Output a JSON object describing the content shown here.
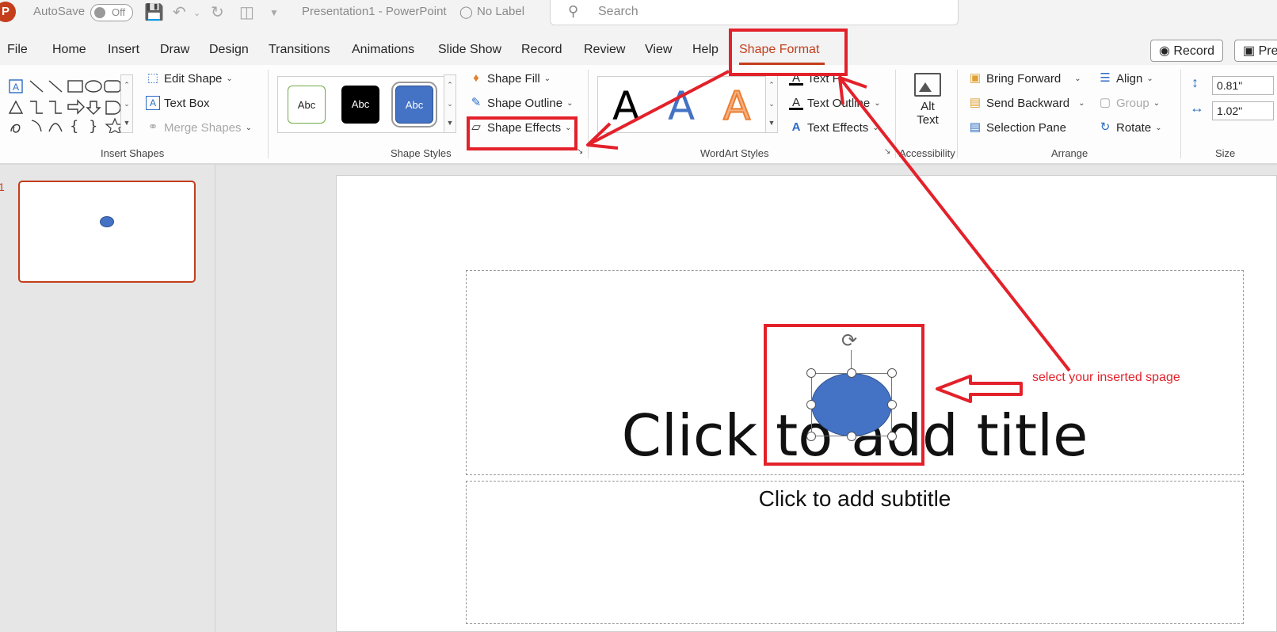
{
  "titlebar": {
    "app_logo": "P",
    "autosave_label": "AutoSave",
    "autosave_state": "Off",
    "document_title": "Presentation1  -  PowerPoint",
    "label_status": "No Label",
    "search_placeholder": "Search"
  },
  "menu": {
    "tabs": [
      "File",
      "Home",
      "Insert",
      "Draw",
      "Design",
      "Transitions",
      "Animations",
      "Slide Show",
      "Record",
      "Review",
      "View",
      "Help",
      "Shape Format"
    ],
    "active_tab": "Shape Format",
    "record_button": "Record",
    "present_button": "Pres"
  },
  "ribbon": {
    "insert_shapes": {
      "edit_shape": "Edit Shape",
      "text_box": "Text Box",
      "merge_shapes": "Merge Shapes",
      "group_label": "Insert Shapes"
    },
    "shape_styles": {
      "style_swatches": [
        "Abc",
        "Abc",
        "Abc"
      ],
      "shape_fill": "Shape Fill",
      "shape_outline": "Shape Outline",
      "shape_effects": "Shape Effects",
      "group_label": "Shape Styles"
    },
    "wordart_styles": {
      "letters": [
        "A",
        "A",
        "A"
      ],
      "text_fill": "Text Fi",
      "text_outline": "Text Outline",
      "text_effects": "Text Effects",
      "group_label": "WordArt Styles"
    },
    "accessibility": {
      "alt_text_line1": "Alt",
      "alt_text_line2": "Text",
      "group_label": "Accessibility"
    },
    "arrange": {
      "bring_forward": "Bring Forward",
      "send_backward": "Send Backward",
      "selection_pane": "Selection Pane",
      "align": "Align",
      "group": "Group",
      "rotate": "Rotate",
      "group_label": "Arrange"
    },
    "size": {
      "height": "0.81\"",
      "width": "1.02\"",
      "group_label": "Size"
    }
  },
  "slides_pane": {
    "slide_number": "1"
  },
  "slide": {
    "title_placeholder": "Click to add title",
    "subtitle_placeholder": "Click to add subtitle"
  },
  "annotation": {
    "note": "select your inserted spage",
    "color": "#e3212a"
  },
  "colors": {
    "accent": "#c43e1c",
    "shape_fill": "#4472c4"
  }
}
